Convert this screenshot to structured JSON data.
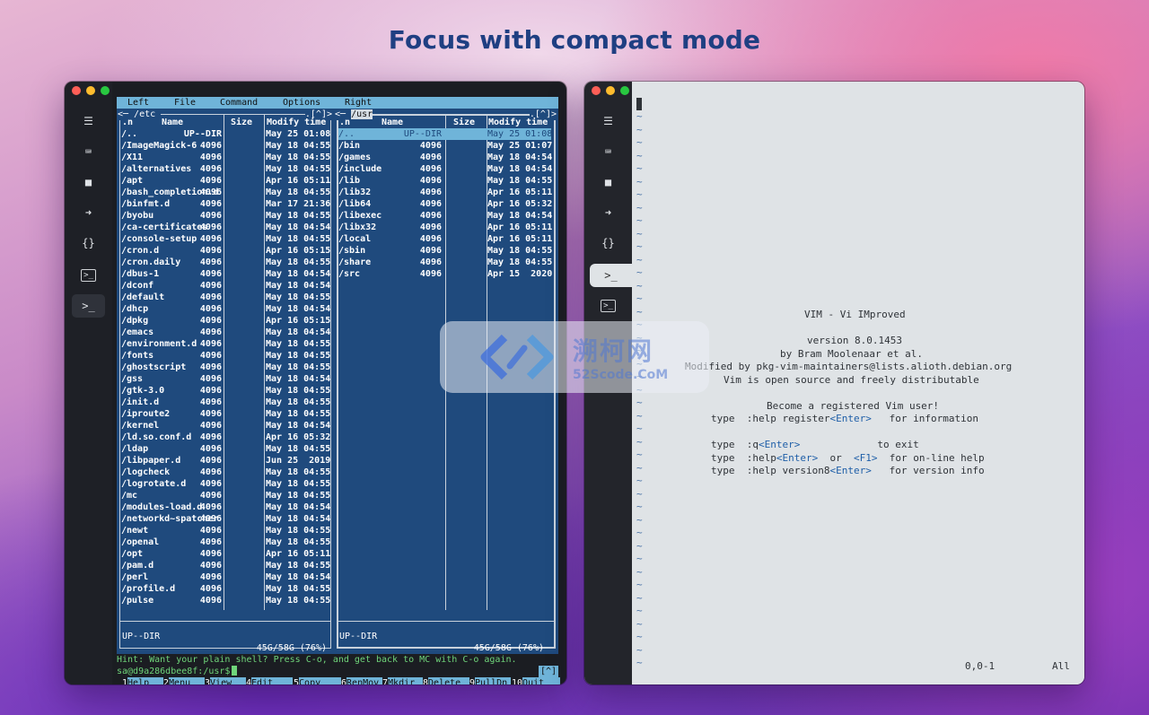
{
  "headline": "Focus with compact mode",
  "sidebar": {
    "icons": [
      "menu-icon",
      "keyboard-icon",
      "folder-icon",
      "forward-arrow-icon",
      "braces-icon",
      "terminal-icon",
      "terminal-icon"
    ],
    "labels": {
      "menu": "☰",
      "keyboard": "⌨",
      "folder": "■",
      "arrow": "➜",
      "braces": "{}",
      "terminal": ">_"
    }
  },
  "mc": {
    "menu": [
      "Left",
      "File",
      "Command",
      "Options",
      "Right"
    ],
    "left_panel": {
      "title_left": "<─ /etc ",
      "title_right": ".[^]>",
      "col_name_prefix": ".n",
      "col_name": "Name",
      "col_size": "Size",
      "col_time": "Modify time",
      "files": [
        {
          "n": "/..",
          "s": "UP--DIR",
          "t": "May 25 01:08"
        },
        {
          "n": "/ImageMagick-6",
          "s": "4096",
          "t": "May 18 04:55"
        },
        {
          "n": "/X11",
          "s": "4096",
          "t": "May 18 04:55"
        },
        {
          "n": "/alternatives",
          "s": "4096",
          "t": "May 18 04:55"
        },
        {
          "n": "/apt",
          "s": "4096",
          "t": "Apr 16 05:11"
        },
        {
          "n": "/bash_completion.d",
          "s": "4096",
          "t": "May 18 04:55"
        },
        {
          "n": "/binfmt.d",
          "s": "4096",
          "t": "Mar 17 21:36"
        },
        {
          "n": "/byobu",
          "s": "4096",
          "t": "May 18 04:55"
        },
        {
          "n": "/ca-certificates",
          "s": "4096",
          "t": "May 18 04:54"
        },
        {
          "n": "/console-setup",
          "s": "4096",
          "t": "May 18 04:55"
        },
        {
          "n": "/cron.d",
          "s": "4096",
          "t": "Apr 16 05:15"
        },
        {
          "n": "/cron.daily",
          "s": "4096",
          "t": "May 18 04:55"
        },
        {
          "n": "/dbus-1",
          "s": "4096",
          "t": "May 18 04:54"
        },
        {
          "n": "/dconf",
          "s": "4096",
          "t": "May 18 04:54"
        },
        {
          "n": "/default",
          "s": "4096",
          "t": "May 18 04:55"
        },
        {
          "n": "/dhcp",
          "s": "4096",
          "t": "May 18 04:54"
        },
        {
          "n": "/dpkg",
          "s": "4096",
          "t": "Apr 16 05:15"
        },
        {
          "n": "/emacs",
          "s": "4096",
          "t": "May 18 04:54"
        },
        {
          "n": "/environment.d",
          "s": "4096",
          "t": "May 18 04:55"
        },
        {
          "n": "/fonts",
          "s": "4096",
          "t": "May 18 04:55"
        },
        {
          "n": "/ghostscript",
          "s": "4096",
          "t": "May 18 04:55"
        },
        {
          "n": "/gss",
          "s": "4096",
          "t": "May 18 04:54"
        },
        {
          "n": "/gtk-3.0",
          "s": "4096",
          "t": "May 18 04:55"
        },
        {
          "n": "/init.d",
          "s": "4096",
          "t": "May 18 04:55"
        },
        {
          "n": "/iproute2",
          "s": "4096",
          "t": "May 18 04:55"
        },
        {
          "n": "/kernel",
          "s": "4096",
          "t": "May 18 04:54"
        },
        {
          "n": "/ld.so.conf.d",
          "s": "4096",
          "t": "Apr 16 05:32"
        },
        {
          "n": "/ldap",
          "s": "4096",
          "t": "May 18 04:55"
        },
        {
          "n": "/libpaper.d",
          "s": "4096",
          "t": "Jun 25  2019"
        },
        {
          "n": "/logcheck",
          "s": "4096",
          "t": "May 18 04:55"
        },
        {
          "n": "/logrotate.d",
          "s": "4096",
          "t": "May 18 04:55"
        },
        {
          "n": "/mc",
          "s": "4096",
          "t": "May 18 04:55"
        },
        {
          "n": "/modules-load.d",
          "s": "4096",
          "t": "May 18 04:54"
        },
        {
          "n": "/networkd~spatcher",
          "s": "4096",
          "t": "May 18 04:54"
        },
        {
          "n": "/newt",
          "s": "4096",
          "t": "May 18 04:55"
        },
        {
          "n": "/openal",
          "s": "4096",
          "t": "May 18 04:55"
        },
        {
          "n": "/opt",
          "s": "4096",
          "t": "Apr 16 05:11"
        },
        {
          "n": "/pam.d",
          "s": "4096",
          "t": "May 18 04:55"
        },
        {
          "n": "/perl",
          "s": "4096",
          "t": "May 18 04:54"
        },
        {
          "n": "/profile.d",
          "s": "4096",
          "t": "May 18 04:55"
        },
        {
          "n": "/pulse",
          "s": "4096",
          "t": "May 18 04:55"
        }
      ],
      "mini_status": "UP--DIR",
      "usage": "45G/58G (76%)"
    },
    "right_panel": {
      "title_left": "<─ ",
      "title_current": "/usr",
      "title_right": ".[^]>",
      "col_name_prefix": ".n",
      "col_name": "Name",
      "col_size": "Size",
      "col_time": "Modify time",
      "files": [
        {
          "n": "/..",
          "s": "UP--DIR",
          "t": "May 25 01:08"
        },
        {
          "n": "/bin",
          "s": "4096",
          "t": "May 25 01:07"
        },
        {
          "n": "/games",
          "s": "4096",
          "t": "May 18 04:54"
        },
        {
          "n": "/include",
          "s": "4096",
          "t": "May 18 04:54"
        },
        {
          "n": "/lib",
          "s": "4096",
          "t": "May 18 04:55"
        },
        {
          "n": "/lib32",
          "s": "4096",
          "t": "Apr 16 05:11"
        },
        {
          "n": "/lib64",
          "s": "4096",
          "t": "Apr 16 05:32"
        },
        {
          "n": "/libexec",
          "s": "4096",
          "t": "May 18 04:54"
        },
        {
          "n": "/libx32",
          "s": "4096",
          "t": "Apr 16 05:11"
        },
        {
          "n": "/local",
          "s": "4096",
          "t": "Apr 16 05:11"
        },
        {
          "n": "/sbin",
          "s": "4096",
          "t": "May 18 04:55"
        },
        {
          "n": "/share",
          "s": "4096",
          "t": "May 18 04:55"
        },
        {
          "n": "/src",
          "s": "4096",
          "t": "Apr 15  2020"
        }
      ],
      "mini_status": "UP--DIR",
      "usage": "45G/58G (76%)"
    },
    "hint": "Hint: Want your plain shell? Press C-o, and get back to MC with C-o again.",
    "prompt": "sa@d9a286dbee8f:/usr$",
    "bracket": "[^]",
    "fkeys": [
      {
        "num": "1",
        "label": "Help"
      },
      {
        "num": "2",
        "label": "Menu"
      },
      {
        "num": "3",
        "label": "View"
      },
      {
        "num": "4",
        "label": "Edit"
      },
      {
        "num": "5",
        "label": "Copy"
      },
      {
        "num": "6",
        "label": "RenMov"
      },
      {
        "num": "7",
        "label": "Mkdir"
      },
      {
        "num": "8",
        "label": "Delete"
      },
      {
        "num": "9",
        "label": "PullDn"
      },
      {
        "num": "10",
        "label": "Quit"
      }
    ]
  },
  "vim": {
    "tilde": "~",
    "tilde_count": 43,
    "title": "VIM - Vi IMproved",
    "version": "version 8.0.1453",
    "author": "by Bram Moolenaar et al.",
    "modified": "Modified by pkg-vim-maintainers@lists.alioth.debian.org",
    "license": "Vim is open source and freely distributable",
    "register_title": "Become a registered Vim user!",
    "help_lines": [
      {
        "a": "type  :help register",
        "k": "<Enter>",
        "b": "   for information"
      },
      {
        "a": "type  :q",
        "k": "<Enter>",
        "b": "             to exit"
      },
      {
        "a": "type  :help",
        "k": "<Enter>",
        "b": "  or  ",
        "k2": "<F1>",
        "c": "  for on-line help"
      },
      {
        "a": "type  :help version8",
        "k": "<Enter>",
        "b": "   for version info"
      }
    ],
    "position": "0,0-1",
    "scroll": "All"
  },
  "watermark": {
    "title": "溯柯网",
    "subtitle": "52Scode.CoM"
  }
}
